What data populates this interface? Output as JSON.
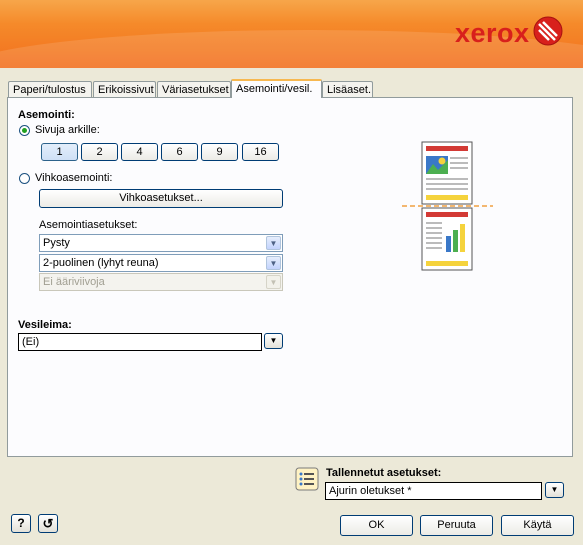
{
  "brand": {
    "logo_text": "xerox",
    "logo_color": "#d8201c",
    "header_color": "#f37a24"
  },
  "tabs": [
    {
      "label": "Paperi/tulostus"
    },
    {
      "label": "Erikoissivut"
    },
    {
      "label": "Väriasetukset"
    },
    {
      "label": "Asemointi/vesil."
    },
    {
      "label": "Lisäaset."
    }
  ],
  "active_tab": "Asemointi/vesil.",
  "layout": {
    "heading": "Asemointi:",
    "pages_per_sheet_label": "Sivuja arkille:",
    "pages_per_sheet_selected": true,
    "page_options": [
      "1",
      "2",
      "4",
      "6",
      "9",
      "16"
    ],
    "selected_pages": "1",
    "booklet_label": "Vihkoasemointi:",
    "booklet_selected": false,
    "booklet_button": "Vihkoasetukset...",
    "settings_label": "Asemointiasetukset:",
    "orientation": "Pysty",
    "duplex": "2-puolinen (lyhyt reuna)",
    "borders": "Ei ääriviivoja"
  },
  "watermark": {
    "label": "Vesileima:",
    "value": "(Ei)"
  },
  "saved": {
    "label": "Tallennetut asetukset:",
    "value": "Ajurin oletukset *"
  },
  "buttons": {
    "ok": "OK",
    "cancel": "Peruuta",
    "apply": "Käytä",
    "help": "?",
    "reset": "↺"
  },
  "preview": {
    "accent_red": "#d33a35",
    "accent_yellow": "#f5d33c",
    "fold_line": "#f0a040"
  }
}
